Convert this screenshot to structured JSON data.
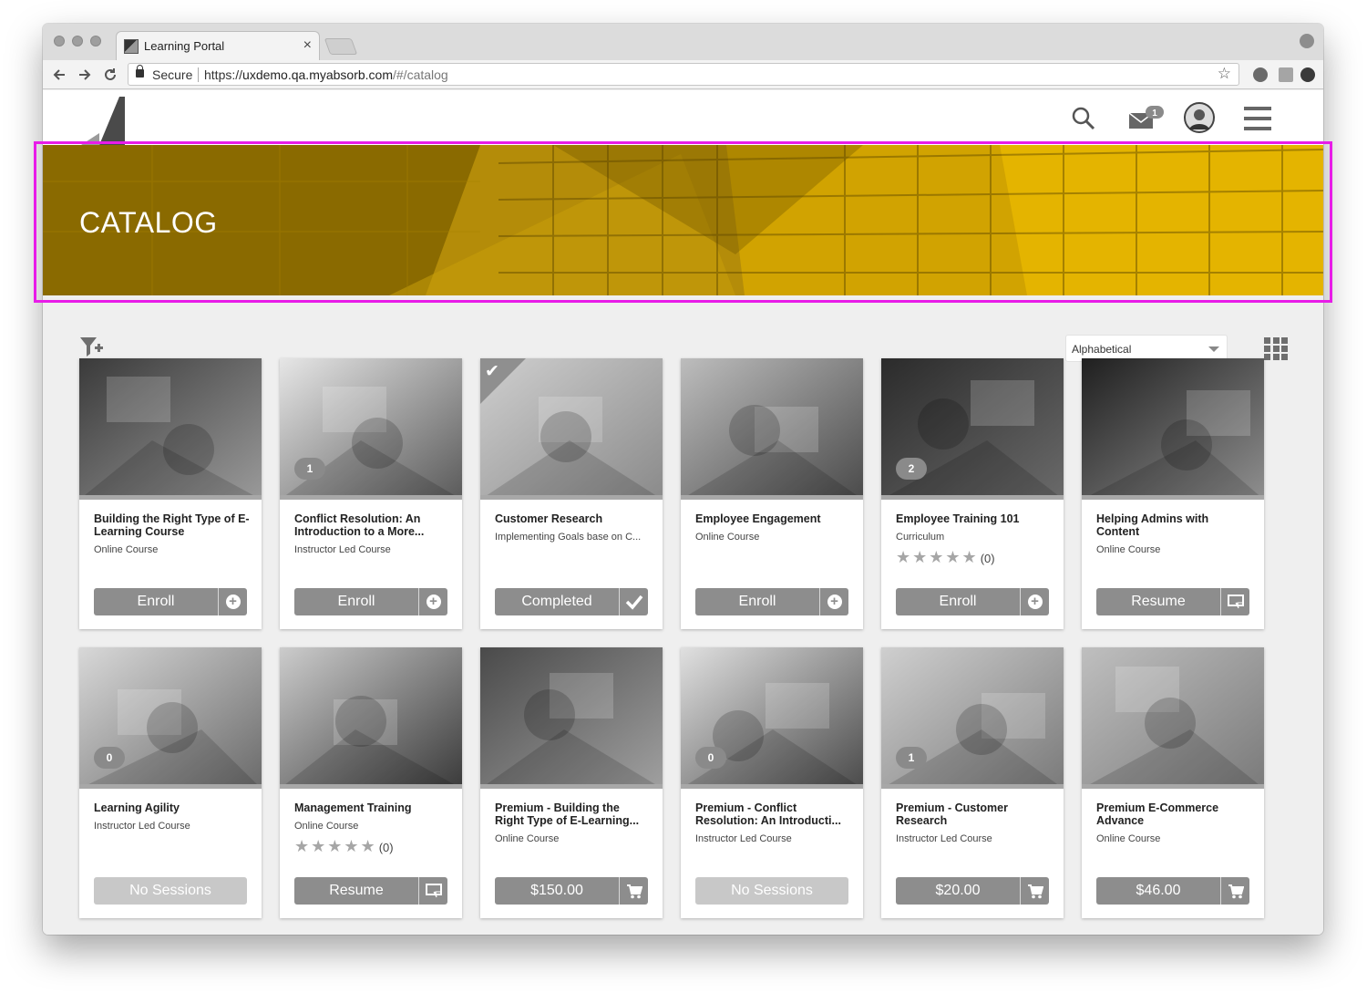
{
  "browser": {
    "tab_title": "Learning Portal",
    "tab_close": "×",
    "secure_label": "Secure",
    "url_scheme": "https://",
    "url_host": "uxdemo.qa.myabsorb.com",
    "url_path": "/#/catalog"
  },
  "header": {
    "mail_badge": "1"
  },
  "banner": {
    "title": "CATALOG"
  },
  "toolbar": {
    "sort_value": "Alphabetical"
  },
  "cards": [
    {
      "title": "Building the Right Type of E-Learning Course",
      "type": "Online Course",
      "action": "Enroll",
      "action_icon": "plus-circle-icon",
      "badge": "",
      "completed": false
    },
    {
      "title": "Conflict Resolution: An Introduction to a More...",
      "type": "Instructor Led Course",
      "action": "Enroll",
      "action_icon": "plus-circle-icon",
      "badge": "1",
      "completed": false
    },
    {
      "title": "Customer Research",
      "type": "Implementing Goals base on C...",
      "action": "Completed",
      "action_icon": "checkmark-icon",
      "badge": "",
      "completed": true
    },
    {
      "title": "Employee Engagement",
      "type": "Online Course",
      "action": "Enroll",
      "action_icon": "plus-circle-icon",
      "badge": "",
      "completed": false
    },
    {
      "title": "Employee Training 101",
      "type": "Curriculum",
      "action": "Enroll",
      "action_icon": "plus-circle-icon",
      "badge": "2",
      "completed": false,
      "rating_count": "(0)"
    },
    {
      "title": "Helping Admins with Content",
      "type": "Online Course",
      "action": "Resume",
      "action_icon": "resume-icon",
      "badge": "",
      "completed": false
    },
    {
      "title": "Learning Agility",
      "type": "Instructor Led Course",
      "action": "No Sessions",
      "action_icon": "",
      "badge": "0",
      "completed": false,
      "disabled": true
    },
    {
      "title": "Management Training",
      "type": "Online Course",
      "action": "Resume",
      "action_icon": "resume-icon",
      "badge": "",
      "completed": false,
      "rating_count": "(0)"
    },
    {
      "title": "Premium - Building the Right Type of E-Learning...",
      "type": "Online Course",
      "action": "$150.00",
      "action_icon": "cart-icon",
      "badge": "",
      "completed": false
    },
    {
      "title": "Premium - Conflict Resolution: An Introducti...",
      "type": "Instructor Led Course",
      "action": "No Sessions",
      "action_icon": "",
      "badge": "0",
      "completed": false,
      "disabled": true
    },
    {
      "title": "Premium - Customer Research",
      "type": "Instructor Led Course",
      "action": "$20.00",
      "action_icon": "cart-icon",
      "badge": "1",
      "completed": false
    },
    {
      "title": "Premium E-Commerce Advance",
      "type": "Online Course",
      "action": "$46.00",
      "action_icon": "cart-icon",
      "badge": "",
      "completed": false
    }
  ],
  "colors": {
    "banner_base": "#8a6a00",
    "banner_accent": "#e0b000",
    "highlight": "#e81ce8",
    "button": "#8d8d8d",
    "button_disabled": "#c8c8c8"
  }
}
